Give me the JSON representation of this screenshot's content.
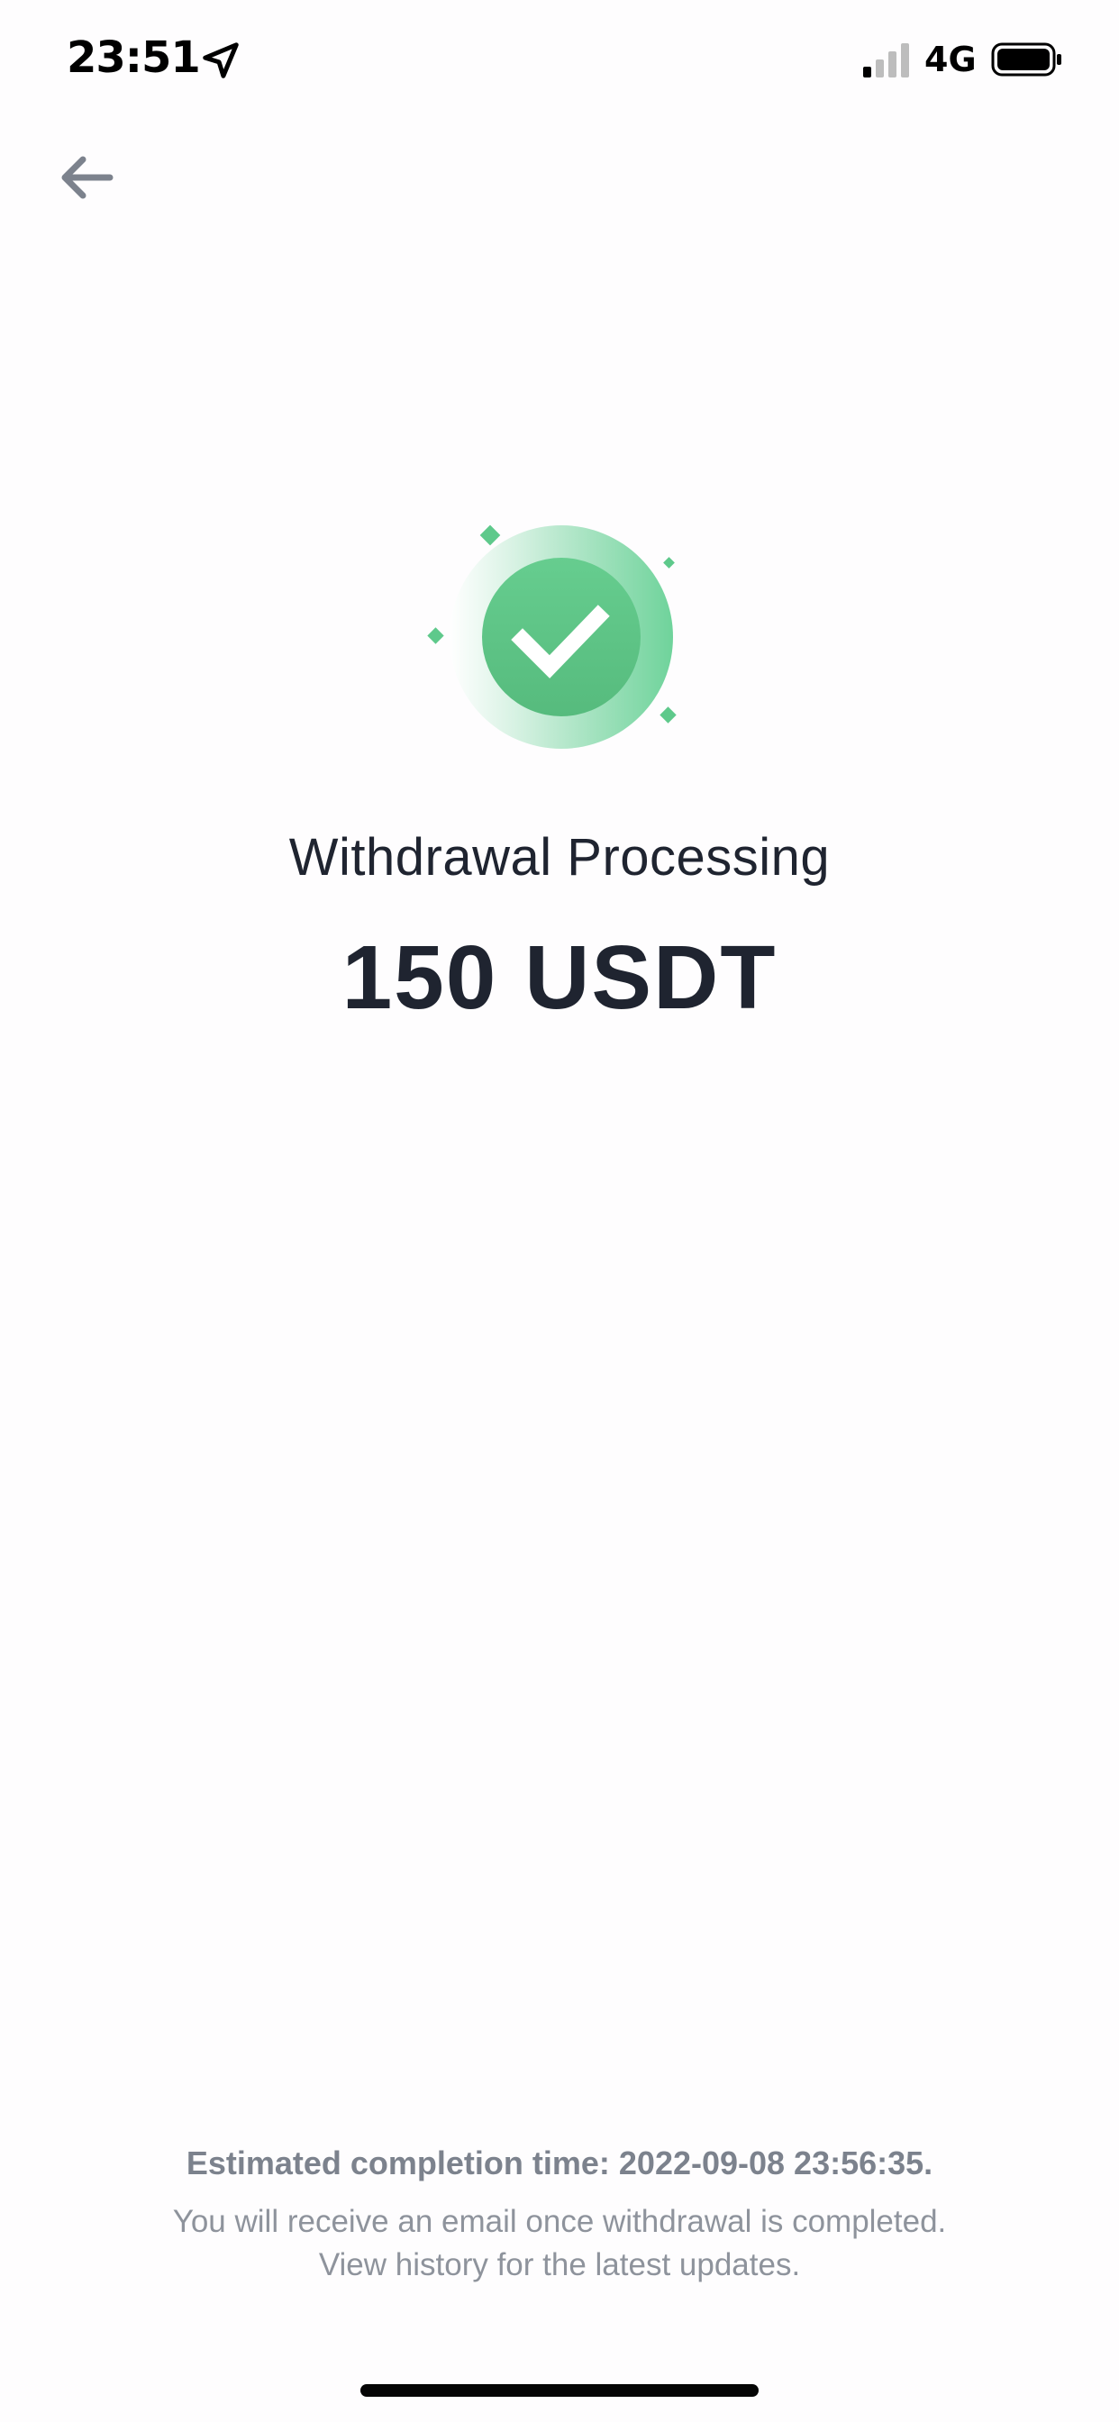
{
  "status_bar": {
    "time": "23:51",
    "network": "4G",
    "location_icon": "location-arrow-icon",
    "signal_icon": "cellular-signal-icon",
    "battery_icon": "battery-full-icon"
  },
  "nav": {
    "back_icon": "arrow-left-icon"
  },
  "result": {
    "icon": "check-circle-icon",
    "title": "Withdrawal Processing",
    "amount": "150 USDT"
  },
  "footer": {
    "estimate": "Estimated completion time: 2022-09-08 23:56:35.",
    "note_line1": "You will receive an email once withdrawal is completed.",
    "note_line2": "View history for the latest updates."
  },
  "colors": {
    "success_green": "#5ec98b",
    "text_dark": "#1f2430",
    "text_muted": "#8e939c",
    "back_arrow": "#7c828d"
  }
}
